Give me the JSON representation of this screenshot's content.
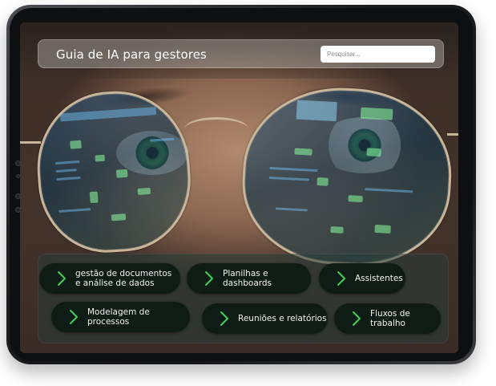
{
  "app": {
    "title": "Guia de IA para gestores"
  },
  "search": {
    "placeholder": "Pesquisar..."
  },
  "topics": [
    {
      "label": "gestão de documentos\ne análise de dados"
    },
    {
      "label": "Planilhas e dashboards"
    },
    {
      "label": "Assistentes"
    },
    {
      "label": "Modelagem de processos"
    },
    {
      "label": "Reuniões e relatórios"
    },
    {
      "label": "Fluxos de trabalho"
    }
  ],
  "colors": {
    "accent": "#3fd05a",
    "pill_bg": "#0f1c16",
    "device_frame": "#1c1d20"
  },
  "icons": {
    "topic_icon": "chevron-right-icon"
  }
}
